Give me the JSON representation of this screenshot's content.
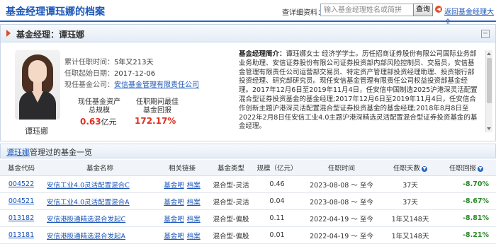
{
  "header": {
    "title": "基金经理谭珏娜的档案",
    "search_label": "查详细资料：",
    "search_placeholder": "输入基金经理姓名或简拼",
    "search_button": "查询",
    "back_link": "返回基金经理大全"
  },
  "profile_bar": {
    "title": "基金经理：谭珏娜"
  },
  "profile": {
    "name": "谭珏娜",
    "tenure_label": "累计任职时间：",
    "tenure_value": "5年又213天",
    "start_label": "任职起始日期：",
    "start_value": "2017-12-06",
    "company_label": "现任基金公司：",
    "company_value": "安信基金管理有限责任公司",
    "assets_label_1": "现任基金资产",
    "assets_label_2": "总规模",
    "assets_value": "0.63",
    "assets_unit": "亿元",
    "best_label_1": "任职期间最佳",
    "best_label_2": "基金回报",
    "best_value": "172.17%",
    "bio_title": "基金经理简介：",
    "bio_text": "谭珏娜女士 经济学学士。历任招商证券股份有限公司国际业务部业务助理、安信证券股份有限公司证券投资部内部风险控制员、交易员，安信基金管理有限责任公司运营部交易员、特定资产管理部投资经理助理、投资银行部投资经理、研究部研究员。现任安信基金管理有限责任公司权益投资部基金经理。2017年12月6日至2019年11月4日，任安信中国制造2025沪港深灵活配置混合型证券投资基金的基金经理;2017年12月6日至2019年11月4日，任安信合作创新主题沪港深灵活配置混合型证券投资基金的基金经理;2018年8月8日至2022年2月8日任安信工业4.0主题沪港深精选灵活配置混合型证券投资基金的基金经理。"
  },
  "fund_bar": {
    "name_link": "谭珏娜",
    "suffix": "管理过的基金一览"
  },
  "table": {
    "columns": [
      "基金代码",
      "基金名称",
      "相关链接",
      "基金类型",
      "规模（亿元）",
      "任职时间",
      "任职天数",
      "任职回报"
    ],
    "rows": [
      {
        "code": "004522",
        "name": "安信工业4.0灵活配置混合C",
        "link1": "基金吧",
        "link2": "档案",
        "type": "混合型-灵活",
        "size": "0.46",
        "period": "2023-08-08 ～ 至今",
        "days": "37天",
        "return": "-8.70%"
      },
      {
        "code": "004521",
        "name": "安信工业4.0灵活配置混合A",
        "link1": "基金吧",
        "link2": "档案",
        "type": "混合型-灵活",
        "size": "0.04",
        "period": "2023-08-08 ～ 至今",
        "days": "37天",
        "return": "-8.67%"
      },
      {
        "code": "013182",
        "name": "安信港股通精选混合发起C",
        "link1": "基金吧",
        "link2": "档案",
        "type": "混合型-偏股",
        "size": "0.11",
        "period": "2022-04-19 ～ 至今",
        "days": "1年又148天",
        "return": "-8.81%"
      },
      {
        "code": "013181",
        "name": "安信港股通精选混合发起A",
        "link1": "基金吧",
        "link2": "档案",
        "type": "混合型-偏股",
        "size": "0.01",
        "period": "2022-04-19 ～ 至今",
        "days": "1年又148天",
        "return": "-8.21%"
      }
    ]
  },
  "colors": {
    "accent": "#1a55b8",
    "negative": "#2a8a2a",
    "highlight": "#e03020"
  }
}
